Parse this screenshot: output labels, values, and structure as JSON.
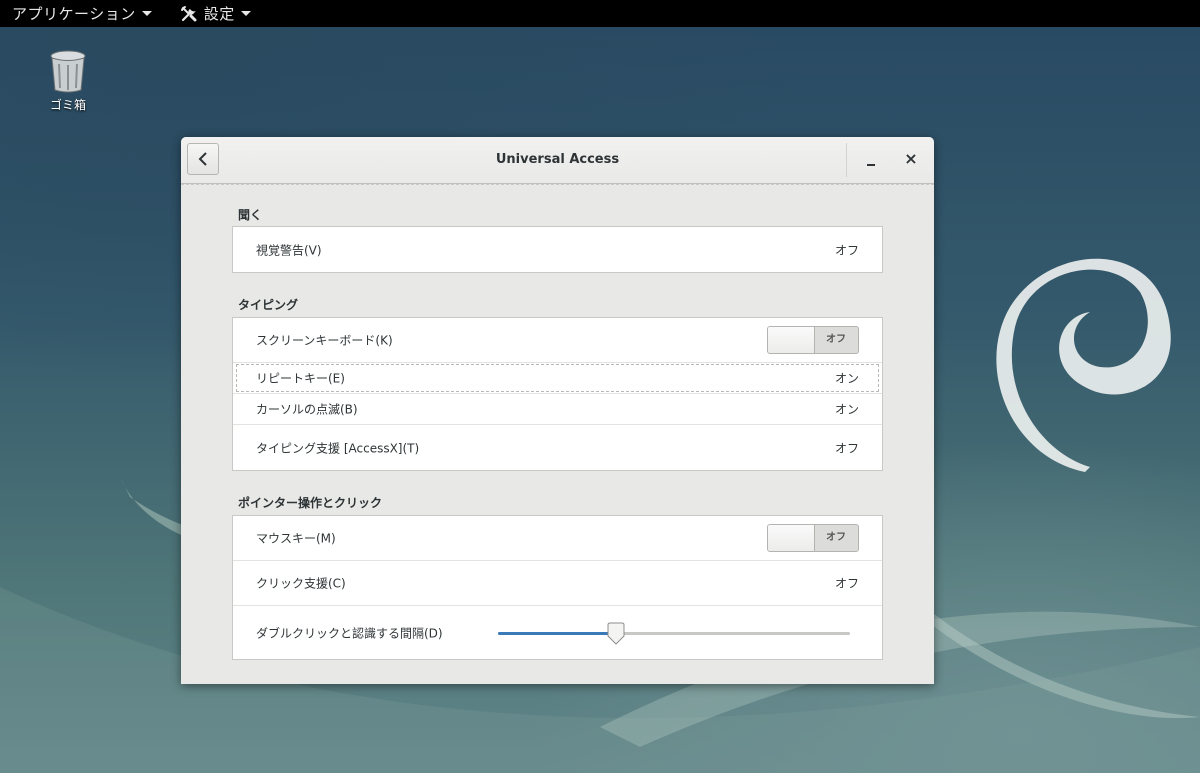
{
  "topbar": {
    "applications_label": "アプリケーション",
    "settings_label": "設定"
  },
  "desktop": {
    "trash_label": "ゴミ箱"
  },
  "window": {
    "title": "Universal Access",
    "close_glyph": "×"
  },
  "sections": {
    "hearing": {
      "heading": "聞く",
      "rows": [
        {
          "label": "視覚警告(V)",
          "value": "オフ"
        }
      ]
    },
    "typing": {
      "heading": "タイピング",
      "rows": [
        {
          "label": "スクリーンキーボード(K)",
          "switch_label": "オフ",
          "switch_on": false
        },
        {
          "label": "リピートキー(E)",
          "value": "オン"
        },
        {
          "label": "カーソルの点滅(B)",
          "value": "オン"
        },
        {
          "label": "タイピング支援 [AccessX](T)",
          "value": "オフ"
        }
      ]
    },
    "pointing": {
      "heading": "ポインター操作とクリック",
      "rows": [
        {
          "label": "マウスキー(M)",
          "switch_label": "オフ",
          "switch_on": false
        },
        {
          "label": "クリック支援(C)",
          "value": "オフ"
        },
        {
          "label": "ダブルクリックと認識する間隔(D)",
          "slider_fraction": 0.335
        }
      ]
    }
  },
  "colors": {
    "accent": "#3a7ab8",
    "window_bg": "#e8e8e7",
    "topbar_bg": "#000000"
  },
  "icons": [
    "tools-icon",
    "trash-icon",
    "back-chevron-icon",
    "minimize-icon",
    "close-icon",
    "caret-down-icon"
  ]
}
